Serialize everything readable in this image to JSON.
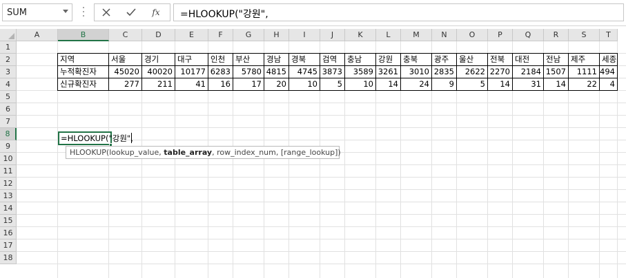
{
  "formula_bar": {
    "name_box": "SUM",
    "cancel_icon": "close-icon",
    "enter_icon": "check-icon",
    "fx_label": "fx",
    "formula": "=HLOOKUP(\"강원\","
  },
  "columns": [
    "A",
    "B",
    "C",
    "D",
    "E",
    "F",
    "G",
    "H",
    "I",
    "J",
    "K",
    "L",
    "M",
    "N",
    "O",
    "P",
    "Q",
    "R",
    "S",
    "T"
  ],
  "rows": [
    "1",
    "2",
    "3",
    "4",
    "5",
    "6",
    "7",
    "8",
    "9",
    "10",
    "11",
    "12",
    "13",
    "14",
    "15",
    "16",
    "17",
    "18"
  ],
  "selected": {
    "column": "B",
    "row": "8"
  },
  "table": {
    "header": [
      "지역",
      "서울",
      "경기",
      "대구",
      "인천",
      "부산",
      "경남",
      "경북",
      "검역",
      "충남",
      "강원",
      "충북",
      "광주",
      "울산",
      "전북",
      "대전",
      "전남",
      "제주",
      "세종"
    ],
    "rows": [
      [
        "누적확진자",
        "45020",
        "40020",
        "10177",
        "6283",
        "5780",
        "4815",
        "4745",
        "3873",
        "3589",
        "3261",
        "3010",
        "2835",
        "2622",
        "2270",
        "2184",
        "1507",
        "1111",
        "494"
      ],
      [
        "신규확진자",
        "277",
        "211",
        "41",
        "16",
        "17",
        "20",
        "10",
        "5",
        "10",
        "14",
        "24",
        "9",
        "5",
        "14",
        "31",
        "14",
        "22",
        "4"
      ]
    ]
  },
  "active_cell": {
    "address": "B8",
    "value": "=HLOOKUP(\"강원\","
  },
  "tooltip": {
    "func": "HLOOKUP(",
    "arg1": "lookup_value, ",
    "arg2": "table_array",
    "rest": ", row_index_num, [range_lookup])"
  },
  "colors": {
    "accent": "#217346",
    "header_bg": "#e6e6e6",
    "gridline": "#e1e1e1"
  }
}
